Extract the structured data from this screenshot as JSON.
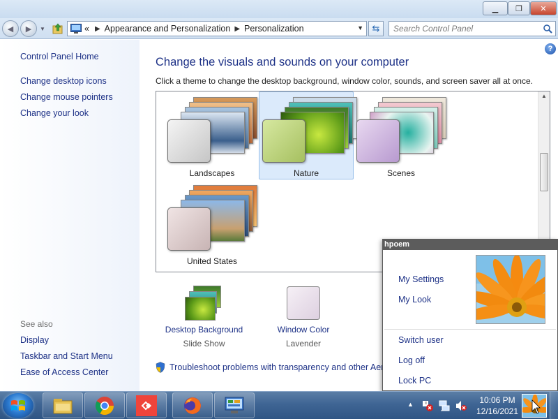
{
  "window": {
    "minimize_icon": "minimize-icon",
    "maximize_icon": "restore-icon",
    "close_icon": "close-icon"
  },
  "address_bar": {
    "overflow": "«",
    "breadcrumb": [
      "Appearance and Personalization",
      "Personalization"
    ],
    "search_placeholder": "Search Control Panel"
  },
  "sidebar": {
    "home": "Control Panel Home",
    "tasks": [
      "Change desktop icons",
      "Change mouse pointers",
      "Change your look"
    ],
    "see_also_label": "See also",
    "see_also": [
      "Display",
      "Taskbar and Start Menu",
      "Ease of Access Center"
    ]
  },
  "main": {
    "help": "?",
    "title": "Change the visuals and sounds on your computer",
    "subtitle": "Click a theme to change the desktop background, window color, sounds, and screen saver all at once.",
    "themes": [
      {
        "label": "Landscapes",
        "selected": false
      },
      {
        "label": "Nature",
        "selected": true
      },
      {
        "label": "Scenes",
        "selected": false
      },
      {
        "label": "United States",
        "selected": false
      }
    ],
    "desktop_background": {
      "label": "Desktop Background",
      "value": "Slide Show"
    },
    "window_color": {
      "label": "Window Color",
      "value": "Lavender"
    },
    "troubleshoot": "Troubleshoot problems with transparency and other Aero"
  },
  "popup": {
    "user": "hpoem",
    "links": [
      "My Settings",
      "My Look"
    ],
    "actions": [
      "Switch user",
      "Log off",
      "Lock PC"
    ]
  },
  "taskbar": {
    "apps": [
      "file-explorer-icon",
      "chrome-icon",
      "anydesk-icon",
      "firefox-icon",
      "control-panel-icon"
    ],
    "time": "10:06 PM",
    "date": "12/16/2021"
  }
}
